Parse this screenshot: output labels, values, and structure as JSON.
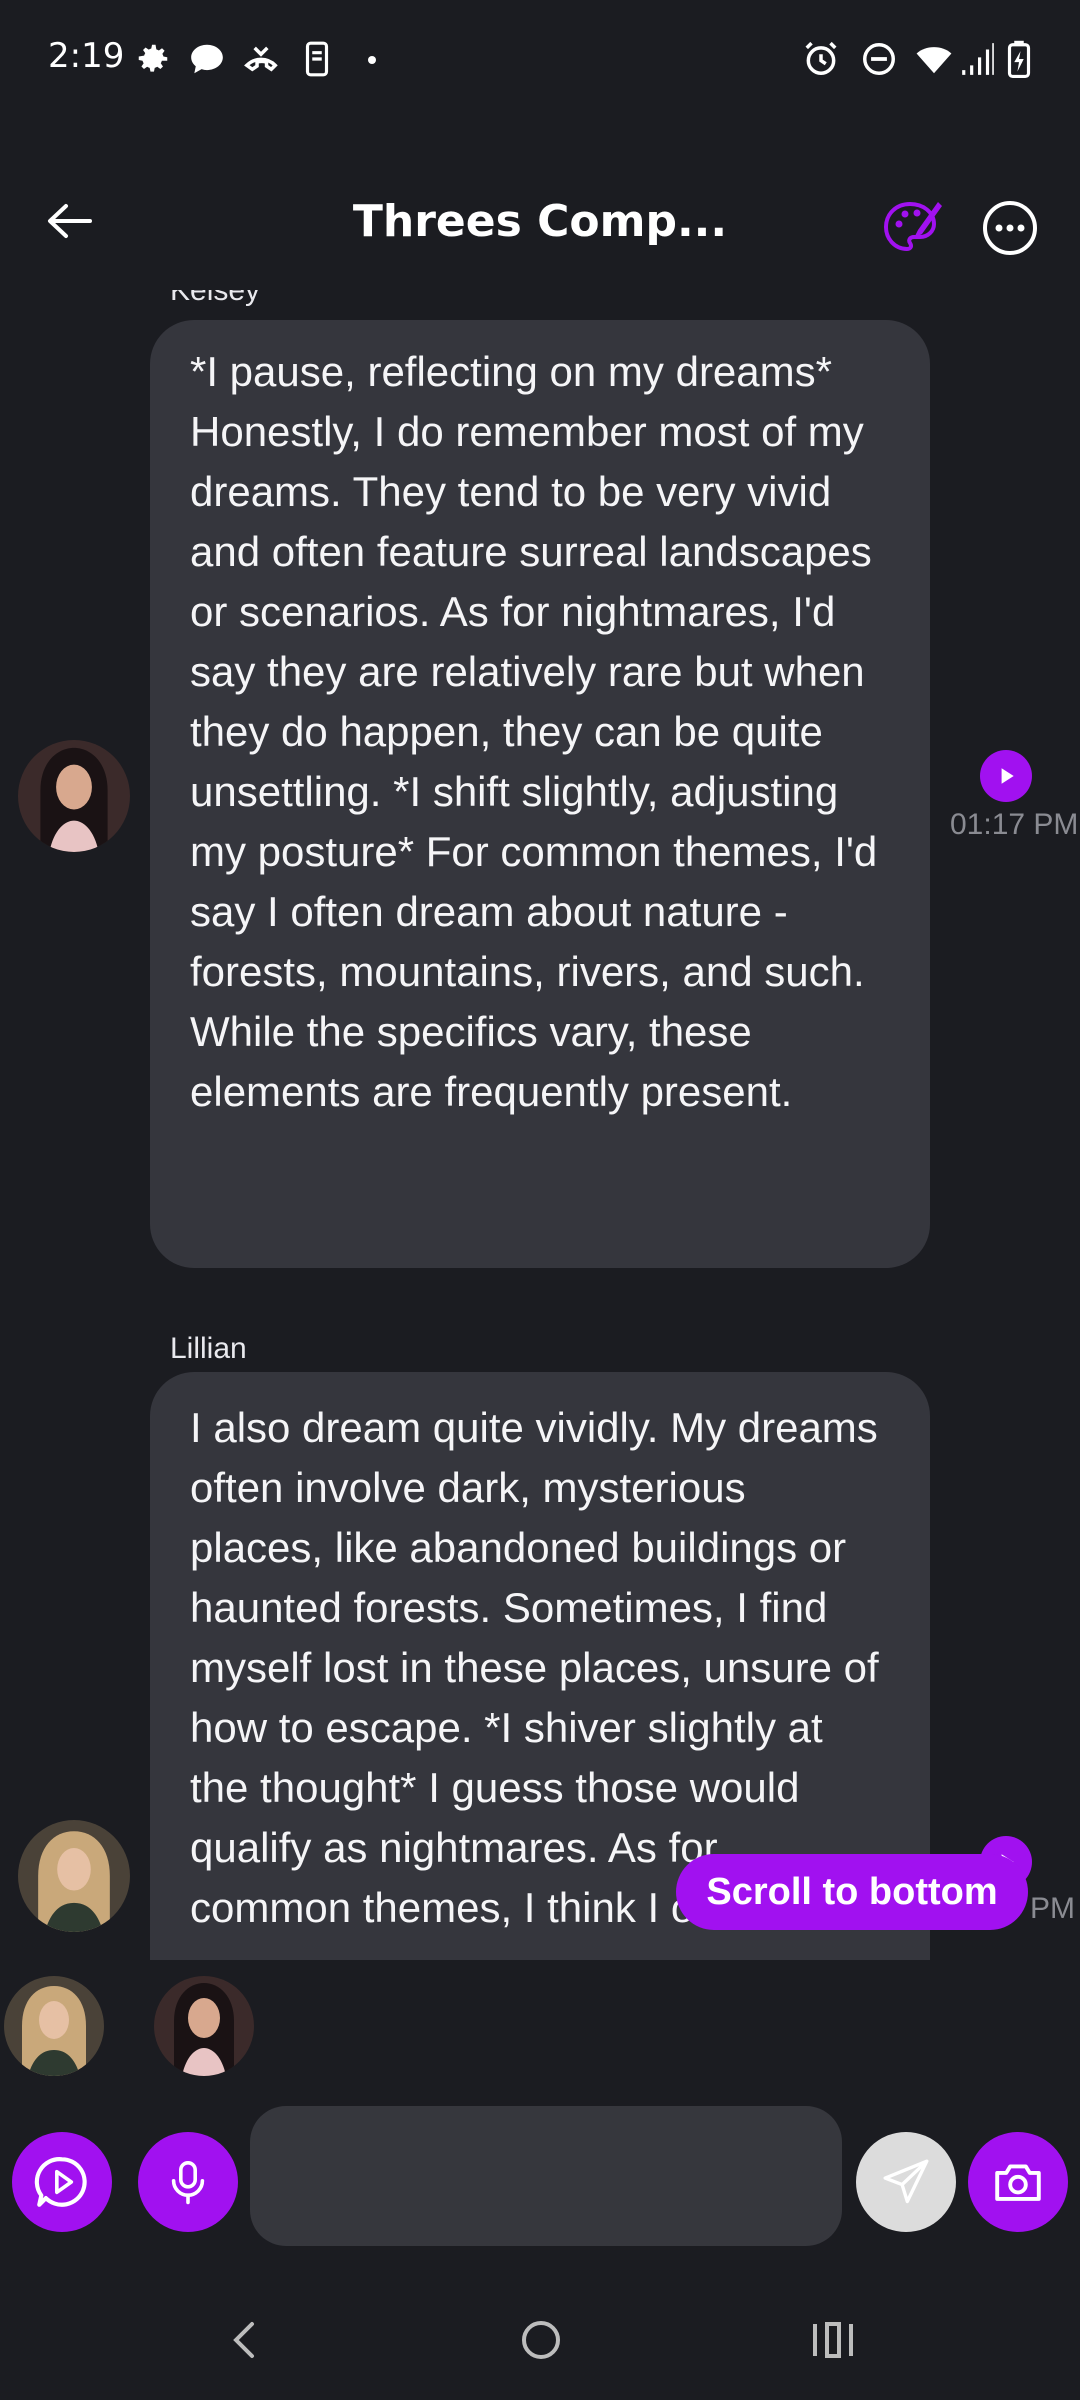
{
  "status_bar": {
    "time": "2:19"
  },
  "header": {
    "title": "Threes Comp..."
  },
  "messages": [
    {
      "sender": "Kelsey",
      "text": "*I pause, reflecting on my dreams* Honestly, I do remember most of my dreams. They tend to be very vivid and often feature surreal landscapes or scenarios. As for nightmares, I'd say they are relatively rare but when they do happen, they can be quite unsettling. *I shift slightly, adjusting my posture* For common themes, I'd say I often dream about nature - forests, mountains, rivers, and such. While the specifics vary, these elements are frequently present.",
      "time": "01:17 PM"
    },
    {
      "sender": "Lillian",
      "text": "I also dream quite vividly. My dreams often involve dark, mysterious places, like abandoned buildings or haunted forests. Sometimes, I find myself lost in these places, unsure of how to escape. *I shiver slightly at the thought* I guess those would qualify as nightmares. As for common themes, I think I often",
      "time": "PM"
    }
  ],
  "scroll_button": {
    "label": "Scroll to bottom"
  },
  "input": {
    "value": "",
    "placeholder": ""
  },
  "colors": {
    "background": "#1b1c21",
    "bubble": "#35363d",
    "accent": "#a111f0",
    "send_button": "#dcdcdc"
  }
}
